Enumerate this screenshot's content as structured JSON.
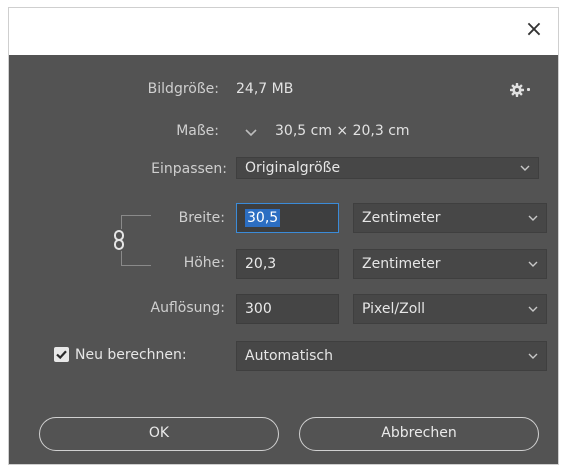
{
  "window": {
    "close_glyph": "×"
  },
  "info": {
    "image_size_label": "Bildgröße:",
    "image_size_value": "24,7 MB",
    "dimensions_label": "Maße:",
    "dimensions_value": "30,5 cm  ×  20,3 cm"
  },
  "fit": {
    "label": "Einpassen:",
    "value": "Originalgröße"
  },
  "width": {
    "label": "Breite:",
    "value": "30,5",
    "unit": "Zentimeter"
  },
  "height": {
    "label": "Höhe:",
    "value": "20,3",
    "unit": "Zentimeter"
  },
  "resolution": {
    "label": "Auflösung:",
    "value": "300",
    "unit": "Pixel/Zoll"
  },
  "resample": {
    "label": "Neu berechnen:",
    "checked": true,
    "value": "Automatisch"
  },
  "buttons": {
    "ok": "OK",
    "cancel": "Abbrechen"
  },
  "colors": {
    "dialog_bg": "#535353",
    "field_bg": "#454545",
    "focus": "#3b8bd8",
    "selection": "#2c6ec2"
  },
  "icons": {
    "settings": "gear-icon",
    "close": "close-icon",
    "link": "chain-link-icon",
    "dropdown": "chevron-down-icon"
  }
}
